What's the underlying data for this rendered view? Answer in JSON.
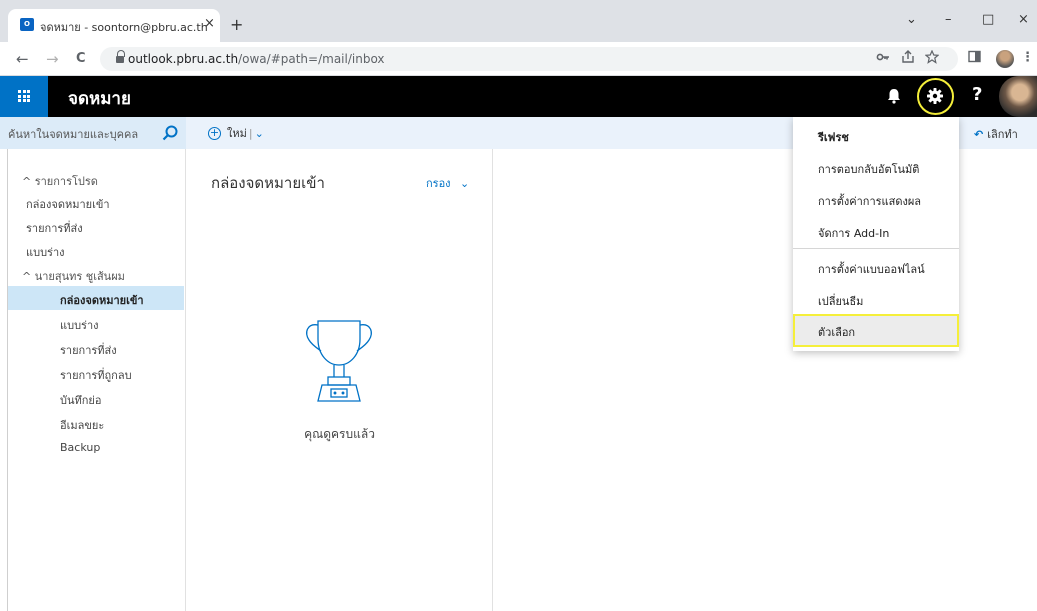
{
  "browser": {
    "tab_title": "จดหมาย - soontorn@pbru.ac.th",
    "tab_close": "×",
    "new_tab": "+",
    "url_host": "outlook.pbru.ac.th",
    "url_path": "/owa/#path=/mail/inbox",
    "back": "←",
    "forward": "→",
    "reload": "C",
    "win_minimize_chevron": "⌄",
    "win_minimize": "–",
    "win_restore": "□",
    "win_close": "×"
  },
  "header": {
    "app_title": "จดหมาย",
    "help": "?"
  },
  "search": {
    "placeholder": "ค้นหาในจดหมายและบุคคล"
  },
  "toolbar": {
    "new_label": "ใหม่",
    "new_separator": "|",
    "new_chevron": "⌄",
    "undo_label": "เลิกทำ"
  },
  "nav": {
    "favorites_group": "^ รายการโปรด",
    "favorites": [
      "กล่องจดหมายเข้า",
      "รายการที่ส่ง",
      "แบบร่าง"
    ],
    "account_group": "^ นายสุนทร ชูเส้นผม",
    "folders": [
      "กล่องจดหมายเข้า",
      "แบบร่าง",
      "รายการที่ส่ง",
      "รายการที่ถูกลบ",
      "บันทึกย่อ",
      "อีเมลขยะ",
      "Backup"
    ],
    "selected_index": 0
  },
  "message_list": {
    "folder_title": "กล่องจดหมายเข้า",
    "filter_label": "กรอง",
    "filter_chevron": "⌄",
    "empty_text": "คุณดูครบแล้ว"
  },
  "settings_menu": {
    "items": [
      "รีเฟรช",
      "การตอบกลับอัตโนมัติ",
      "การตั้งค่าการแสดงผล",
      "จัดการ Add-In",
      "การตั้งค่าแบบออฟไลน์",
      "เปลี่ยนธีม",
      "ตัวเลือก"
    ],
    "highlighted_index": 6
  },
  "colors": {
    "accent": "#0072c6",
    "header_bg": "#000000",
    "highlight_ring": "#f5ef3a",
    "nav_selected_bg": "#cde6f7"
  }
}
